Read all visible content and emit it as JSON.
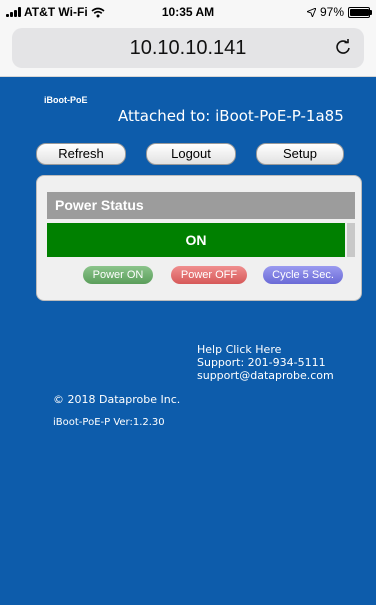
{
  "status_bar": {
    "carrier": "AT&T Wi-Fi",
    "time": "10:35 AM",
    "battery": "97%",
    "battery_level": 0.97
  },
  "browser": {
    "url": "10.10.10.141"
  },
  "page": {
    "brand": "iBoot-PoE",
    "attached": "Attached to: iBoot-PoE-P-1a85",
    "nav": {
      "refresh": "Refresh",
      "logout": "Logout",
      "setup": "Setup"
    },
    "power_panel": {
      "title": "Power Status",
      "status": "ON",
      "status_color": "#008000",
      "buttons": {
        "on": "Power ON",
        "off": "Power OFF",
        "cycle": "Cycle 5 Sec."
      }
    },
    "help": {
      "link": "Help Click Here",
      "support_phone": "Support: 201-934-5111",
      "support_email": "support@dataprobe.com"
    },
    "copyright": "© 2018 Dataprobe Inc.",
    "version": "iBoot-PoE-P Ver:1.2.30"
  },
  "colors": {
    "page_background": "#0d5cab",
    "panel_header": "#9c9c9c",
    "power_on": "#5b9e5b",
    "power_off": "#d65858",
    "cycle": "#6a6ad6"
  }
}
